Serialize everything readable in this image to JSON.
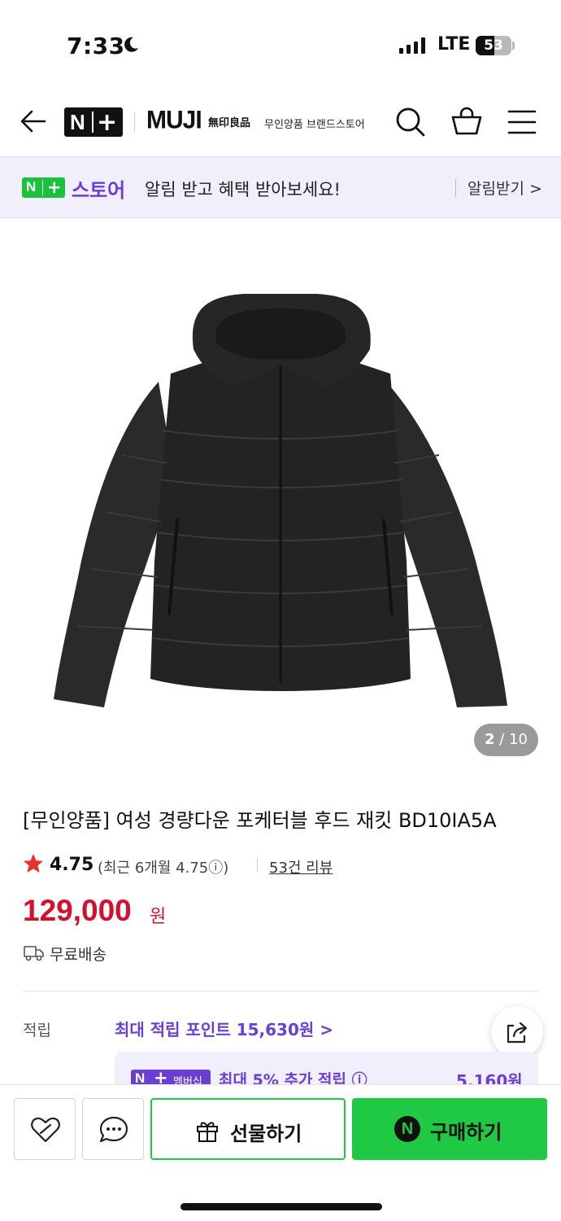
{
  "status_bar": {
    "time": "7:33",
    "network": "LTE",
    "battery_percent": "53",
    "battery_level": 0.53,
    "icons": [
      "moon-icon",
      "signal-icon",
      "battery-icon"
    ]
  },
  "header": {
    "logo_badge": "N",
    "logo_plus": "+",
    "brand": "MUJI",
    "brand_kanji": "無印良品",
    "brand_store_label": "무인양품 브랜드스토어",
    "icons": [
      "back-arrow-icon",
      "search-icon",
      "cart-icon",
      "menu-icon"
    ]
  },
  "banner": {
    "logo_badge": "N",
    "logo_plus": "+",
    "store_label": "스토어",
    "message": "알림 받고 혜택 받아보세요!",
    "action_label": "알림받기 >"
  },
  "gallery": {
    "current": "2",
    "separator": " / ",
    "total": "10"
  },
  "product": {
    "title": "[무인양품] 여성 경량다운 포케터블 후드 재킷 BD10IA5A",
    "rating": "4.75",
    "rating_recent": "(최근 6개월 4.75ⓘ)",
    "review_count": "53건 리뷰",
    "price": "129,000",
    "price_unit": "원",
    "shipping": "무료배송"
  },
  "points": {
    "label": "적립",
    "max_points": "최대 적립 포인트 15,630원 >",
    "membership_badge_n": "N",
    "membership_badge_plus": "+",
    "membership_badge_text": "멤버십",
    "membership_text": "최대 5% 추가 적립 ⓘ",
    "membership_amount": "5,160원"
  },
  "bottom_bar": {
    "gift_label": "선물하기",
    "buy_logo": "N",
    "buy_label": "구매하기",
    "icons": [
      "heart-link-icon",
      "chat-bubble-icon",
      "gift-icon",
      "naver-pay-icon"
    ]
  },
  "colors": {
    "accent_purple": "#6a3fd6",
    "naver_green": "#1fc944",
    "price_red": "#d5102d",
    "banner_bg": "#f1effb"
  }
}
